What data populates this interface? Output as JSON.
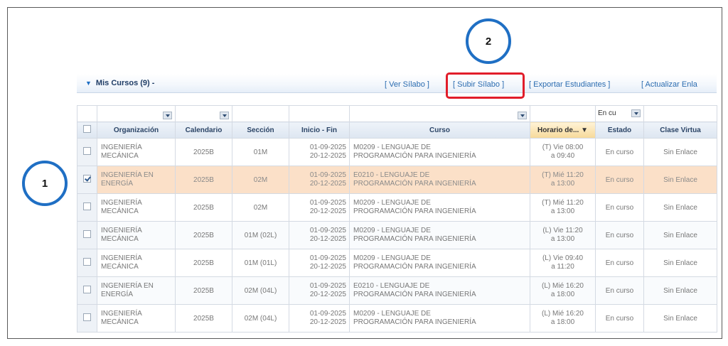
{
  "header": {
    "section_title": "Mis Cursos (9) -",
    "actions": [
      "[ Ver Sílabo ]",
      "[ Subir Sílabo ]",
      "[ Exportar Estudiantes ]",
      "[ Actualizar Enla"
    ]
  },
  "annotations": {
    "callout_1": "1",
    "callout_2": "2"
  },
  "filters": {
    "estado": "En cu"
  },
  "columns": [
    "Organización",
    "Calendario",
    "Sección",
    "Inicio - Fin",
    "Curso",
    "Horario de...",
    "Estado",
    "Clase Virtua"
  ],
  "sorted_column": "Horario de...",
  "rows": [
    {
      "checked": false,
      "org": [
        "INGENIERÍA",
        "MECÁNICA"
      ],
      "cal": "2025B",
      "sec": "01M",
      "dates": [
        "01-09-2025",
        "20-12-2025"
      ],
      "curso": [
        "M0209 - LENGUAJE DE",
        "PROGRAMACIÓN PARA INGENIERÍA"
      ],
      "horario": [
        "(T) Vie 08:00",
        "a 09:40"
      ],
      "estado": "En curso",
      "clase": "Sin Enlace"
    },
    {
      "checked": true,
      "org": [
        "INGENIERÍA EN",
        "ENERGÍA"
      ],
      "cal": "2025B",
      "sec": "02M",
      "dates": [
        "01-09-2025",
        "20-12-2025"
      ],
      "curso": [
        "E0210 - LENGUAJE DE",
        "PROGRAMACIÓN PARA INGENIERÍA"
      ],
      "horario": [
        "(T) Mié 11:20",
        "a 13:00"
      ],
      "estado": "En curso",
      "clase": "Sin Enlace"
    },
    {
      "checked": false,
      "org": [
        "INGENIERÍA",
        "MECÁNICA"
      ],
      "cal": "2025B",
      "sec": "02M",
      "dates": [
        "01-09-2025",
        "20-12-2025"
      ],
      "curso": [
        "M0209 - LENGUAJE DE",
        "PROGRAMACIÓN PARA INGENIERÍA"
      ],
      "horario": [
        "(T) Mié 11:20",
        "a 13:00"
      ],
      "estado": "En curso",
      "clase": "Sin Enlace"
    },
    {
      "checked": false,
      "org": [
        "INGENIERÍA",
        "MECÁNICA"
      ],
      "cal": "2025B",
      "sec": "01M (02L)",
      "dates": [
        "01-09-2025",
        "20-12-2025"
      ],
      "curso": [
        "M0209 - LENGUAJE DE",
        "PROGRAMACIÓN PARA INGENIERÍA"
      ],
      "horario": [
        "(L) Vie 11:20",
        "a 13:00"
      ],
      "estado": "En curso",
      "clase": "Sin Enlace"
    },
    {
      "checked": false,
      "org": [
        "INGENIERÍA",
        "MECÁNICA"
      ],
      "cal": "2025B",
      "sec": "01M (01L)",
      "dates": [
        "01-09-2025",
        "20-12-2025"
      ],
      "curso": [
        "M0209 - LENGUAJE DE",
        "PROGRAMACIÓN PARA INGENIERÍA"
      ],
      "horario": [
        "(L) Vie 09:40",
        "a 11:20"
      ],
      "estado": "En curso",
      "clase": "Sin Enlace"
    },
    {
      "checked": false,
      "org": [
        "INGENIERÍA EN",
        "ENERGÍA"
      ],
      "cal": "2025B",
      "sec": "02M (04L)",
      "dates": [
        "01-09-2025",
        "20-12-2025"
      ],
      "curso": [
        "E0210 - LENGUAJE DE",
        "PROGRAMACIÓN PARA INGENIERÍA"
      ],
      "horario": [
        "(L) Mié 16:20",
        "a 18:00"
      ],
      "estado": "En curso",
      "clase": "Sin Enlace"
    },
    {
      "checked": false,
      "org": [
        "INGENIERÍA",
        "MECÁNICA"
      ],
      "cal": "2025B",
      "sec": "02M (04L)",
      "dates": [
        "01-09-2025",
        "20-12-2025"
      ],
      "curso": [
        "M0209 - LENGUAJE DE",
        "PROGRAMACIÓN PARA INGENIERÍA"
      ],
      "horario": [
        "(L) Mié 16:20",
        "a 18:00"
      ],
      "estado": "En curso",
      "clase": "Sin Enlace"
    }
  ],
  "colors": {
    "callout_circle": "#1f6fc4",
    "callout_box": "#e11d2a",
    "selected_row": "#fbe0c8",
    "link": "#2b6cb0"
  }
}
